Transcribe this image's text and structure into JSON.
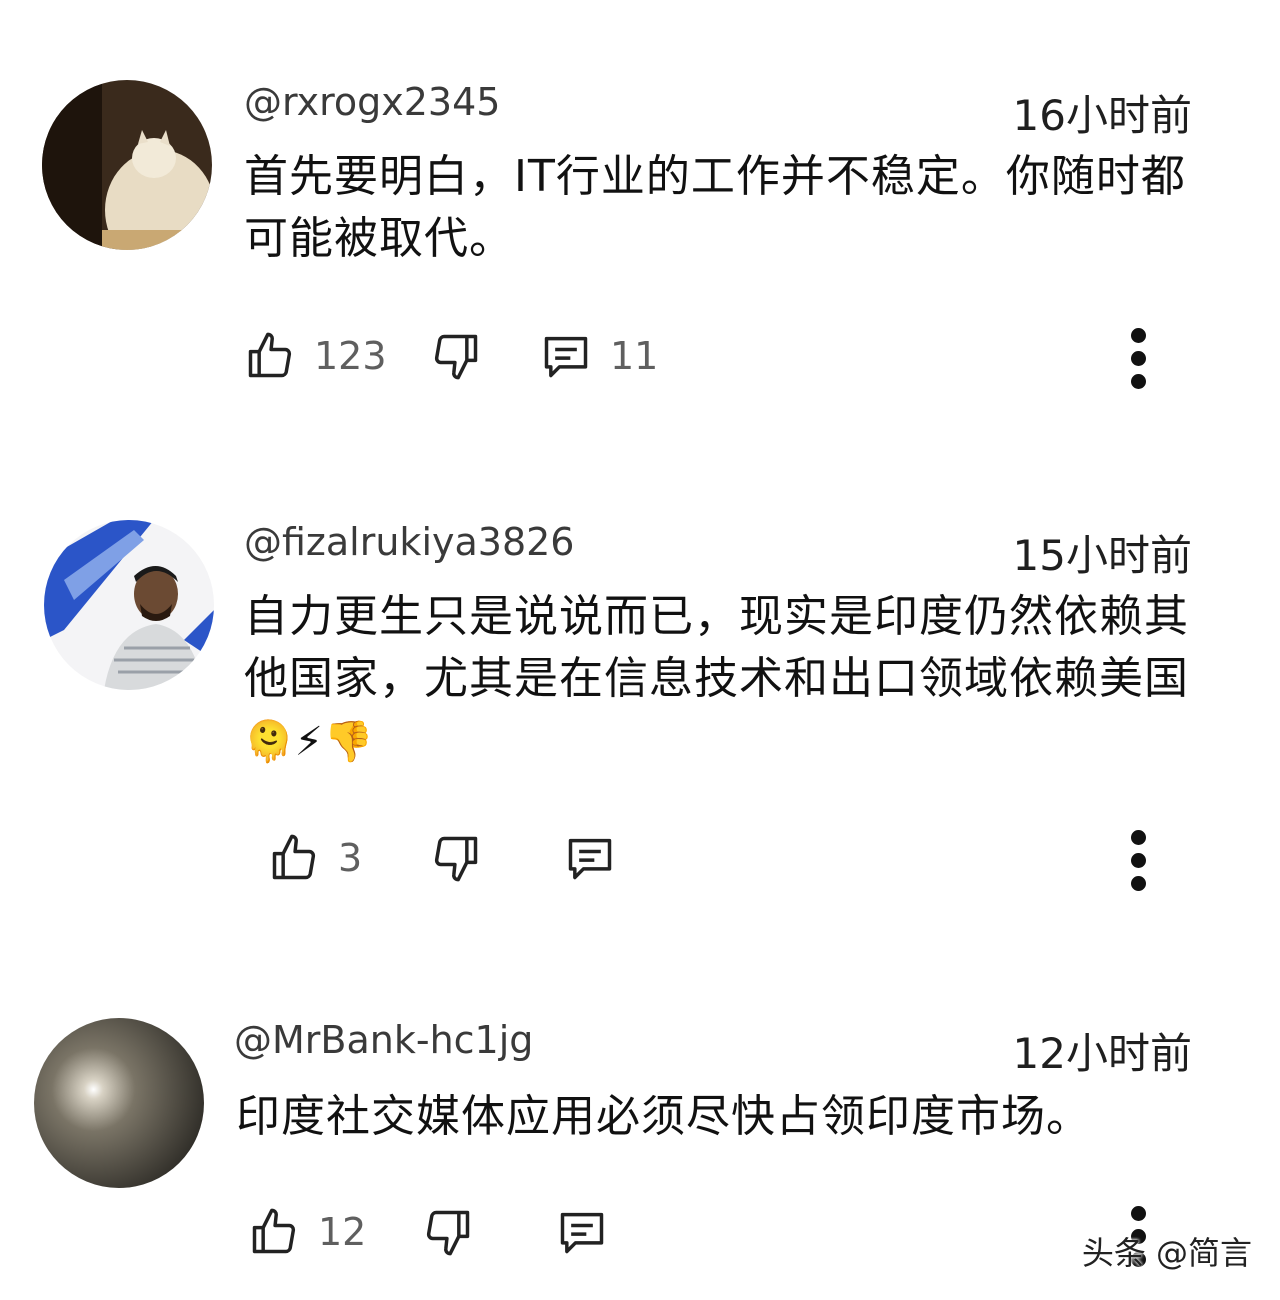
{
  "comments": [
    {
      "username": "@rxrogx2345",
      "time": "16小时前",
      "text": "首先要明白，IT行业的工作并不稳定。你随时都可能被取代。",
      "likes": "123",
      "replies": "11"
    },
    {
      "username": "@fizalrukiya3826",
      "time": "15小时前",
      "text": "自力更生只是说说而已，现实是印度仍然依赖其他国家，尤其是在信息技术和出口领域依赖美国",
      "emojis": "🫠⚡👎",
      "likes": "3",
      "replies": ""
    },
    {
      "username": "@MrBank-hc1jg",
      "time": "12小时前",
      "text": "印度社交媒体应用必须尽快占领印度市场。",
      "likes": "12",
      "replies": ""
    }
  ],
  "watermark": "头条 @简言",
  "colors": {
    "text": "#111111",
    "meta": "#5f5f5f",
    "background": "#ffffff"
  },
  "icons": [
    "thumb-up-icon",
    "thumb-down-icon",
    "reply-icon",
    "more-vert-icon"
  ]
}
